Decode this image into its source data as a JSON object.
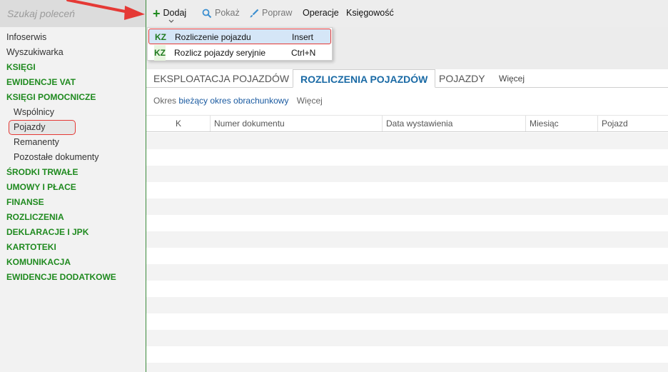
{
  "search": {
    "placeholder": "Szukaj poleceń"
  },
  "sidebar": {
    "items": [
      {
        "label": "Infoserwis",
        "kind": "plain"
      },
      {
        "label": "Wyszukiwarka",
        "kind": "plain"
      },
      {
        "label": "KSIĘGI",
        "kind": "group"
      },
      {
        "label": "EWIDENCJE VAT",
        "kind": "group"
      },
      {
        "label": "KSIĘGI POMOCNICZE",
        "kind": "group"
      },
      {
        "label": "Wspólnicy",
        "kind": "sub"
      },
      {
        "label": "Pojazdy",
        "kind": "sub",
        "selected": true
      },
      {
        "label": "Remanenty",
        "kind": "sub"
      },
      {
        "label": "Pozostałe dokumenty",
        "kind": "sub"
      },
      {
        "label": "ŚRODKI TRWAŁE",
        "kind": "group"
      },
      {
        "label": "UMOWY I PŁACE",
        "kind": "group"
      },
      {
        "label": "FINANSE",
        "kind": "group"
      },
      {
        "label": "ROZLICZENIA",
        "kind": "group"
      },
      {
        "label": "DEKLARACJE I JPK",
        "kind": "group"
      },
      {
        "label": "KARTOTEKI",
        "kind": "group"
      },
      {
        "label": "KOMUNIKACJA",
        "kind": "group"
      },
      {
        "label": "EWIDENCJE DODATKOWE",
        "kind": "group"
      }
    ]
  },
  "toolbar": {
    "dodaj": "Dodaj",
    "pokaz": "Pokaż",
    "popraw": "Popraw",
    "operacje": "Operacje",
    "ksiegowosc": "Księgowość"
  },
  "dropdown": {
    "items": [
      {
        "badge": "KZ",
        "label": "Rozliczenie pojazdu",
        "shortcut": "Insert"
      },
      {
        "badge": "KZ",
        "label": "Rozlicz pojazdy seryjnie",
        "shortcut": "Ctrl+N"
      }
    ]
  },
  "tabs": {
    "items": [
      "EKSPLOATACJA POJAZDÓW",
      "ROZLICZENIA POJAZDÓW",
      "POJAZDY"
    ],
    "active": "ROZLICZENIA POJAZDÓW",
    "more": "Więcej"
  },
  "filter": {
    "prefix": "Okres",
    "link": "bieżący okres obrachunkowy",
    "more": "Więcej"
  },
  "table": {
    "columns": [
      "K",
      "Numer dokumentu",
      "Data wystawienia",
      "Miesiąc",
      "Pojazd"
    ],
    "rows": []
  },
  "colors": {
    "accent_green": "#1f8a1f",
    "highlight_red": "#e53935",
    "active_tab_blue": "#1a6aa5"
  }
}
